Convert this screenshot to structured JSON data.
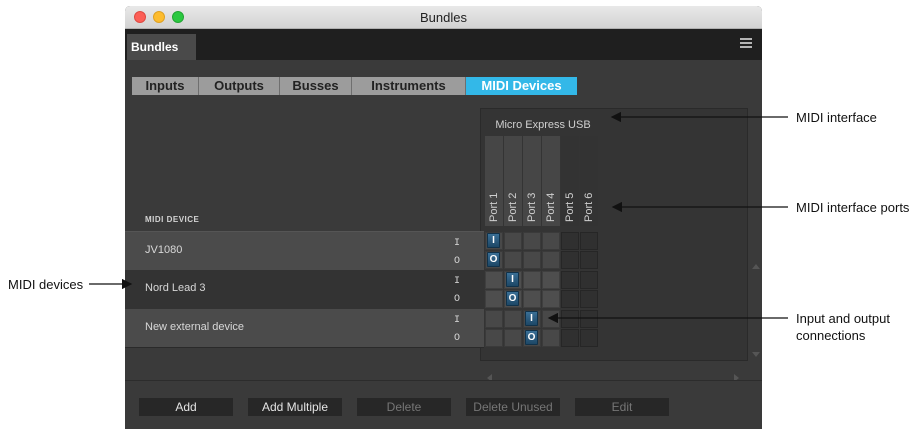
{
  "window": {
    "title": "Bundles"
  },
  "panel_tab": "Bundles",
  "menu_icon": "hamburger-menu-icon",
  "category_tabs": [
    {
      "label": "Inputs",
      "active": false
    },
    {
      "label": "Outputs",
      "active": false
    },
    {
      "label": "Busses",
      "active": false
    },
    {
      "label": "Instruments",
      "active": false
    },
    {
      "label": "MIDI Devices",
      "active": true
    }
  ],
  "matrix": {
    "interface_name": "Micro Express USB",
    "ports": [
      "Port 1",
      "Port 2",
      "Port 3",
      "Port 4",
      "Port 5",
      "Port 6"
    ],
    "device_header": "MIDI DEVICE",
    "devices": [
      {
        "name": "JV1080",
        "in_label": "I",
        "out_label": "O",
        "input_port": "Port 1",
        "output_port": "Port 1"
      },
      {
        "name": "Nord Lead 3",
        "in_label": "I",
        "out_label": "O",
        "input_port": "Port 2",
        "output_port": "Port 2"
      },
      {
        "name": "New external device",
        "in_label": "I",
        "out_label": "O",
        "input_port": "Port 3",
        "output_port": "Port 3"
      }
    ],
    "toggle_in_text": "I",
    "toggle_out_text": "O"
  },
  "footer_buttons": [
    {
      "label": "Add",
      "enabled": true
    },
    {
      "label": "Add Multiple",
      "enabled": true
    },
    {
      "label": "Delete",
      "enabled": false
    },
    {
      "label": "Delete Unused",
      "enabled": false
    },
    {
      "label": "Edit",
      "enabled": false
    }
  ],
  "annotations": {
    "midi_interface": "MIDI interface",
    "midi_interface_ports": "MIDI interface ports",
    "midi_devices": "MIDI devices",
    "io_connections_line1": "Input and output",
    "io_connections_line2": "connections"
  },
  "colors": {
    "active_tab": "#33b8e8",
    "toggle": "#2a5a80",
    "window_bg": "#3a3a3a"
  }
}
